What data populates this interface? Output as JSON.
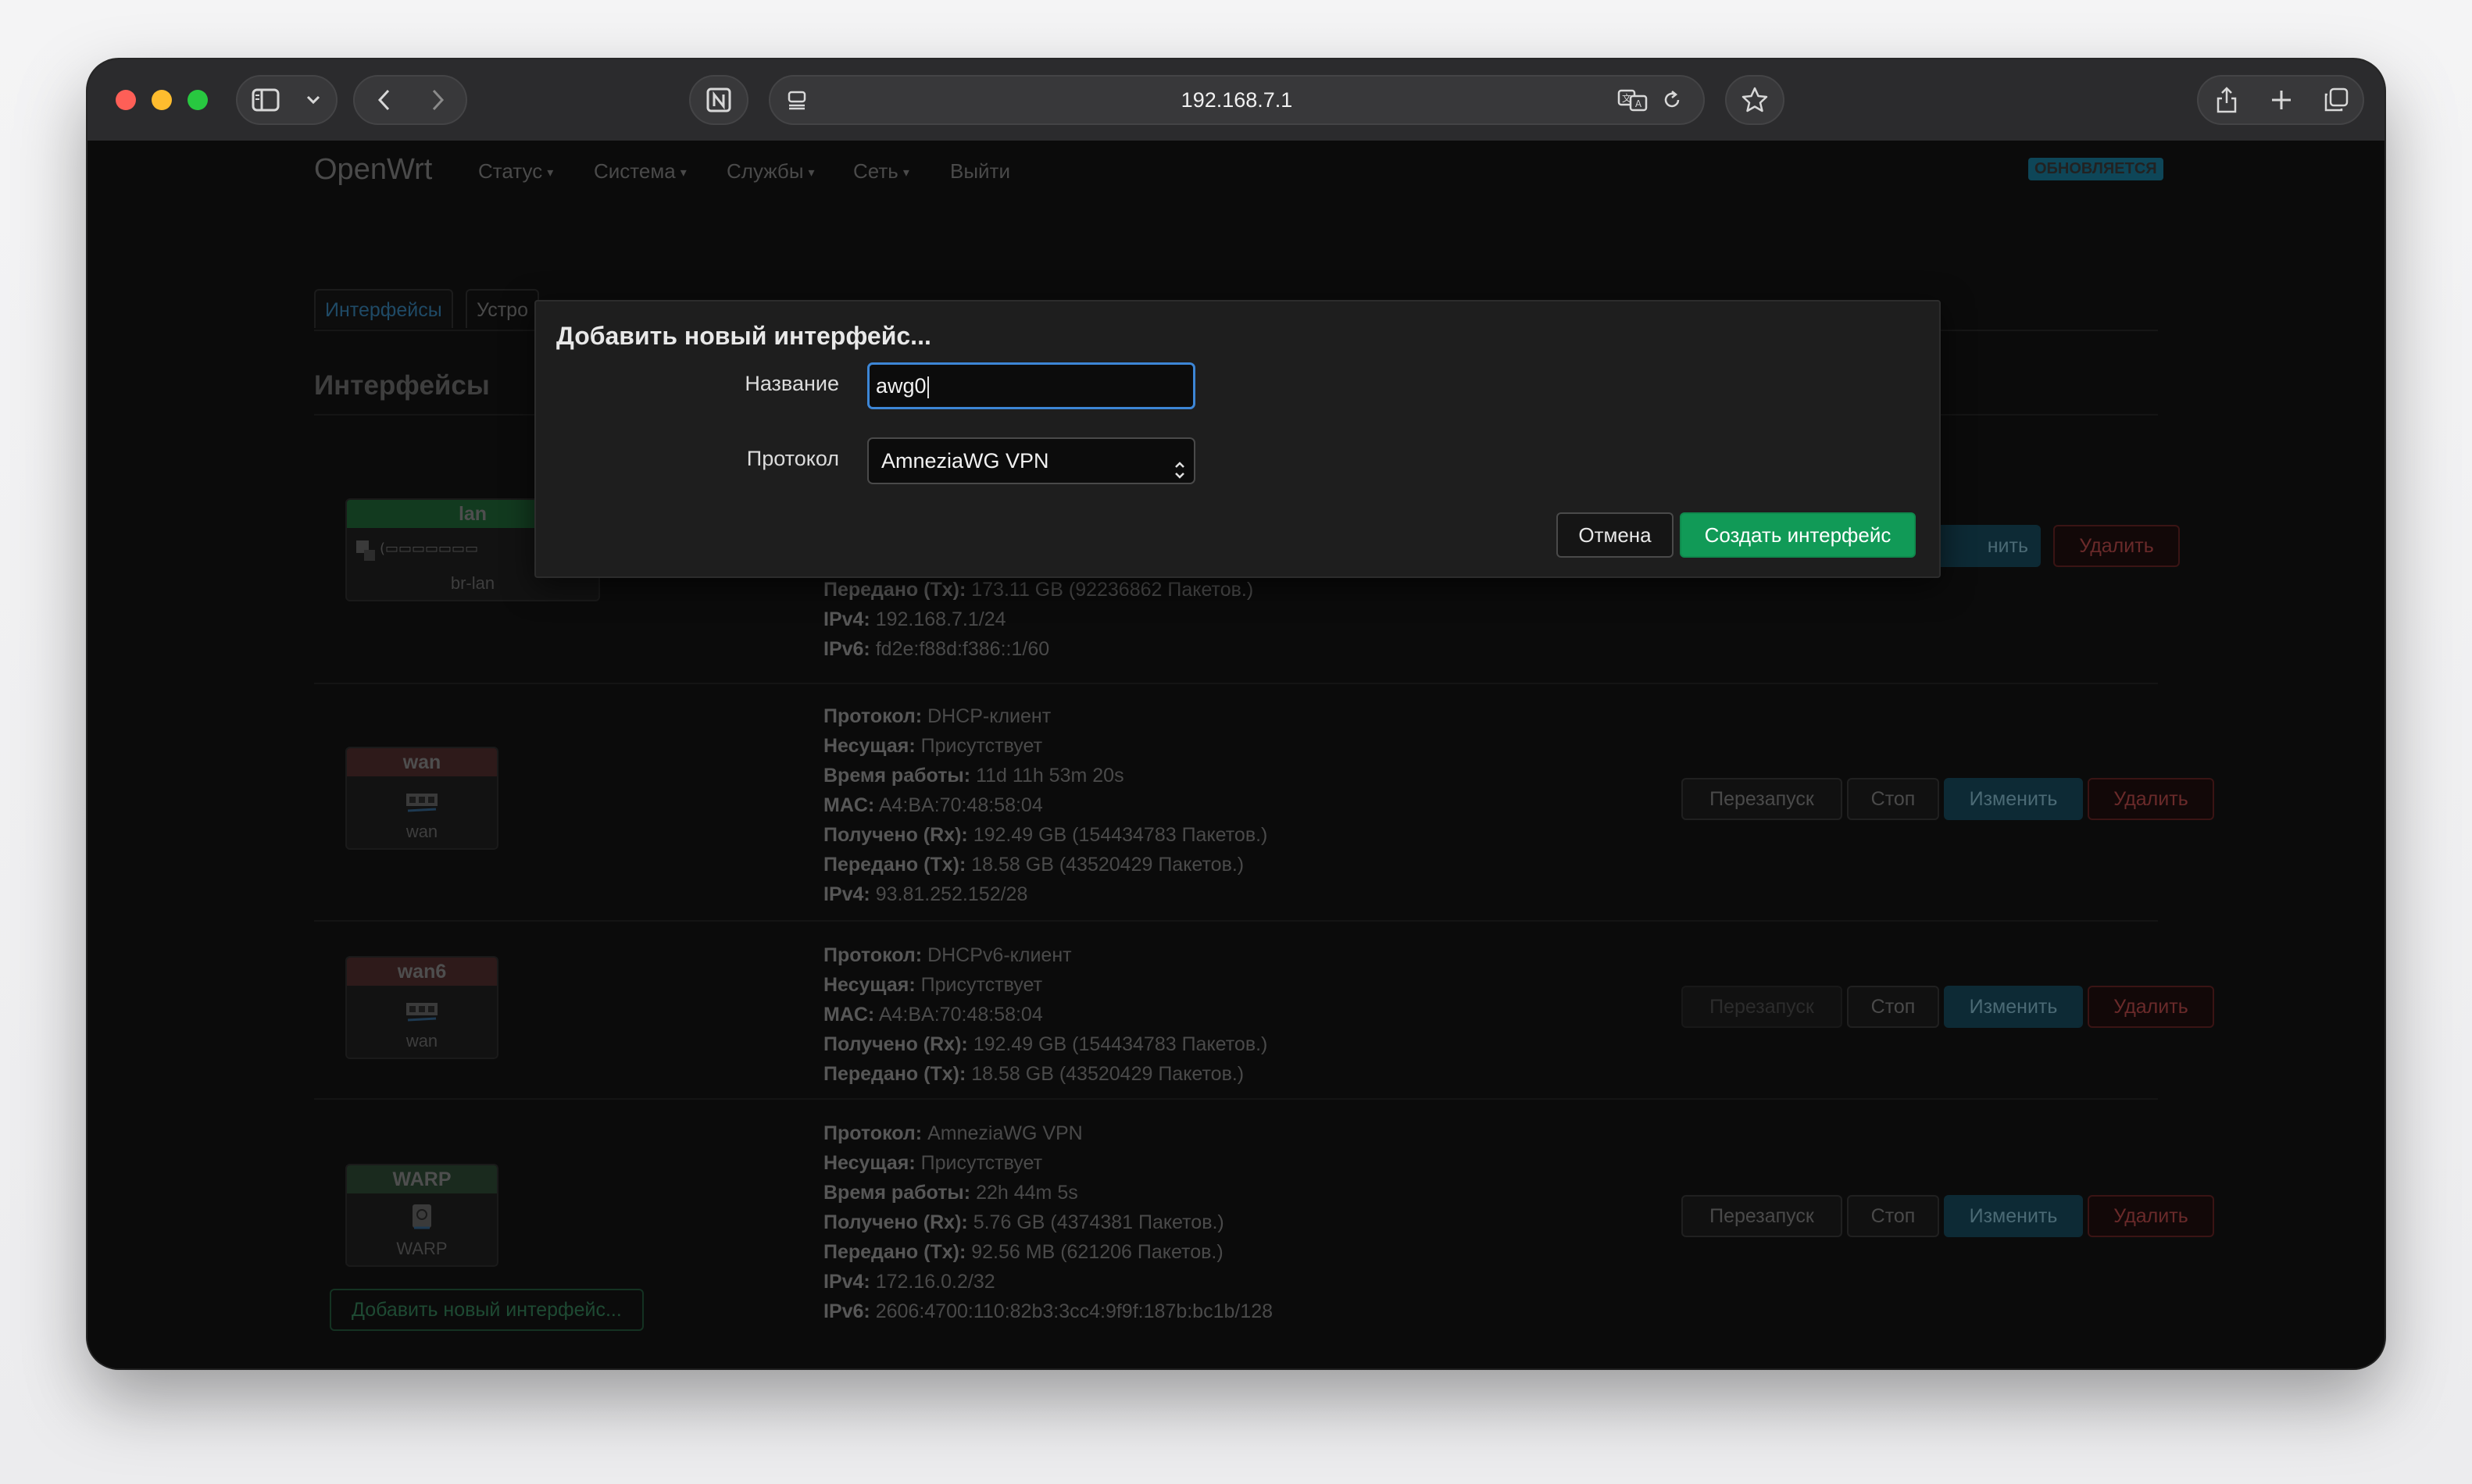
{
  "browser": {
    "url": "192.168.7.1"
  },
  "nav": {
    "brand": "OpenWrt",
    "items": [
      "Статус",
      "Система",
      "Службы",
      "Сеть"
    ],
    "logout": "Выйти",
    "status_badge": "ОБНОВЛЯЕТСЯ"
  },
  "tabs": [
    {
      "label": "Интерфейсы",
      "active": true
    },
    {
      "label": "Устро",
      "active": false
    }
  ],
  "section_title": "Интерфейсы",
  "buttons": {
    "restart": "Перезапуск",
    "stop": "Стоп",
    "edit": "Изменить",
    "delete": "Удалить",
    "edit_partial": "нить",
    "add_interface": "Добавить новый интерфейс..."
  },
  "interfaces": [
    {
      "name": "lan",
      "device": "br-lan",
      "head_color": "#123a1f",
      "info": [
        {
          "k": "Передано (Tx):",
          "v": "173.11 GB (92236862 Пакетов.)"
        },
        {
          "k": "IPv4:",
          "v": "192.168.7.1/24"
        },
        {
          "k": "IPv6:",
          "v": "fd2e:f88d:f386::1/60"
        }
      ]
    },
    {
      "name": "wan",
      "device": "wan",
      "head_color": "#2e1a1a",
      "info": [
        {
          "k": "Протокол:",
          "v": "DHCP-клиент"
        },
        {
          "k": "Несущая:",
          "v": "Присутствует"
        },
        {
          "k": "Время работы:",
          "v": "11d 11h 53m 20s"
        },
        {
          "k": "MAC:",
          "v": "A4:BA:70:48:58:04"
        },
        {
          "k": "Получено (Rx):",
          "v": "192.49 GB (154434783 Пакетов.)"
        },
        {
          "k": "Передано (Tx):",
          "v": "18.58 GB (43520429 Пакетов.)"
        },
        {
          "k": "IPv4:",
          "v": "93.81.252.152/28"
        }
      ]
    },
    {
      "name": "wan6",
      "device": "wan",
      "head_color": "#2e1a1a",
      "info": [
        {
          "k": "Протокол:",
          "v": "DHCPv6-клиент"
        },
        {
          "k": "Несущая:",
          "v": "Присутствует"
        },
        {
          "k": "MAC:",
          "v": "A4:BA:70:48:58:04"
        },
        {
          "k": "Получено (Rx):",
          "v": "192.49 GB (154434783 Пакетов.)"
        },
        {
          "k": "Передано (Tx):",
          "v": "18.58 GB (43520429 Пакетов.)"
        }
      ]
    },
    {
      "name": "WARP",
      "device": "WARP",
      "head_color": "#1a2a1e",
      "info": [
        {
          "k": "Протокол:",
          "v": "AmneziaWG VPN"
        },
        {
          "k": "Несущая:",
          "v": "Присутствует"
        },
        {
          "k": "Время работы:",
          "v": "22h 44m 5s"
        },
        {
          "k": "Получено (Rx):",
          "v": "5.76 GB (4374381 Пакетов.)"
        },
        {
          "k": "Передано (Tx):",
          "v": "92.56 MB (621206 Пакетов.)"
        },
        {
          "k": "IPv4:",
          "v": "172.16.0.2/32"
        },
        {
          "k": "IPv6:",
          "v": "2606:4700:110:82b3:3cc4:9f9f:187b:bc1b/128"
        }
      ]
    }
  ],
  "modal": {
    "title": "Добавить новый интерфейс...",
    "name_label": "Название",
    "name_value": "awg0",
    "protocol_label": "Протокол",
    "protocol_value": "AmneziaWG VPN",
    "cancel": "Отмена",
    "create": "Создать интерфейс"
  }
}
